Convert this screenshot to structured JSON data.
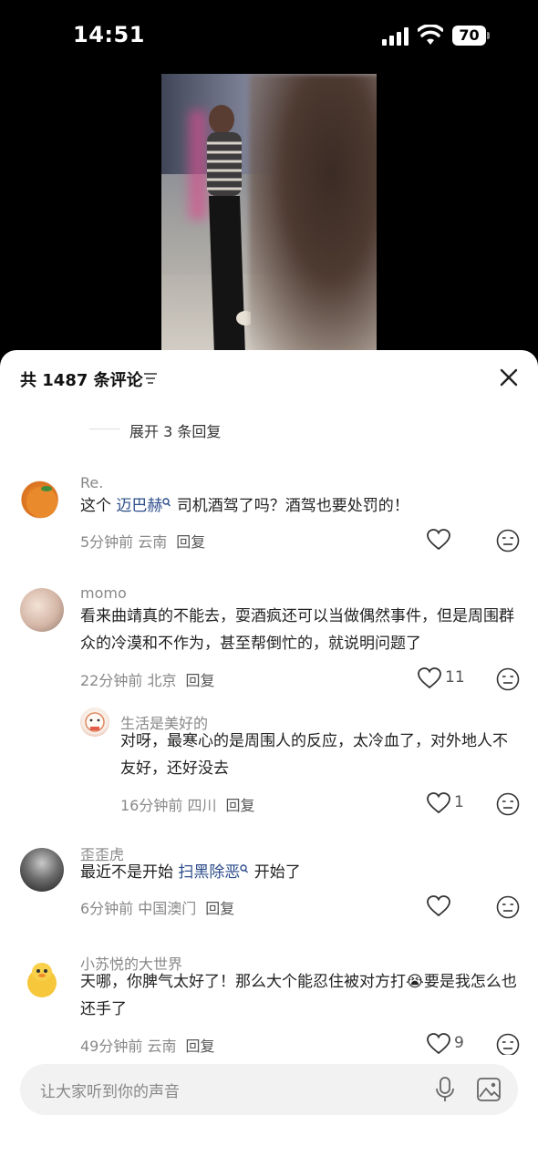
{
  "status_bar": {
    "time": "14:51",
    "battery": "70"
  },
  "sheet": {
    "title": "共 1487 条评论"
  },
  "expand": {
    "label": "展开 3 条回复"
  },
  "comments": [
    {
      "username": "Re.",
      "text_before": "这个 ",
      "link": "迈巴赫",
      "text_after": " 司机酒驾了吗？酒驾也要处罚的！",
      "time": "5分钟前",
      "location": "云南",
      "reply": "回复",
      "likes": ""
    },
    {
      "username": "momo",
      "text": "看来曲靖真的不能去，耍酒疯还可以当做偶然事件，但是周围群众的冷漠和不作为，甚至帮倒忙的，就说明问题了",
      "time": "22分钟前",
      "location": "北京",
      "reply": "回复",
      "likes": "11"
    },
    {
      "username": "生活是美好的",
      "text": "对呀，最寒心的是周围人的反应，太冷血了，对外地人不友好，还好没去",
      "time": "16分钟前",
      "location": "四川",
      "reply": "回复",
      "likes": "1"
    },
    {
      "username": "歪歪虎",
      "text_before": "最近不是开始 ",
      "link": "扫黑除恶",
      "text_after": " 开始了",
      "time": "6分钟前",
      "location": "中国澳门",
      "reply": "回复",
      "likes": ""
    },
    {
      "username": "小苏悦的大世界",
      "text": "天哪，你脾气太好了！那么大个能忍住被对方打😭要是我怎么也还手了",
      "time": "49分钟前",
      "location": "云南",
      "reply": "回复",
      "likes": "9"
    }
  ],
  "input": {
    "placeholder": "让大家听到你的声音"
  },
  "colors": {
    "link": "#2b4c8a",
    "meta": "#888888",
    "sheet_bg": "#ffffff",
    "screen_bg": "#000000"
  },
  "icons": [
    "signal-icon",
    "wifi-icon",
    "battery-icon",
    "sort-icon",
    "close-icon",
    "search-link-icon",
    "heart-icon",
    "emoji-reaction-icon",
    "mic-icon",
    "image-icon"
  ]
}
